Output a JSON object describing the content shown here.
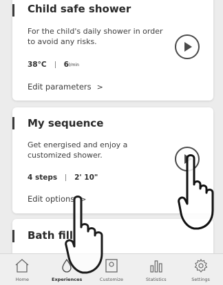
{
  "cards": [
    {
      "title": "Child safe shower",
      "description": "For the child's daily shower in order to avoid any risks.",
      "meta_left": "38°C",
      "meta_right_value": "6",
      "meta_right_unit": "l/min",
      "edit_label": "Edit parameters",
      "chevron": ">"
    },
    {
      "title": "My sequence",
      "description": "Get energised and enjoy a customized shower.",
      "meta_left": "4 steps",
      "meta_right_value": "2' 10\"",
      "edit_label": "Edit options",
      "chevron": ">"
    },
    {
      "title": "Bath fill"
    }
  ],
  "tabs": [
    {
      "label": "Home",
      "icon": "home-icon"
    },
    {
      "label": "Experiences",
      "icon": "drop-icon",
      "active": true
    },
    {
      "label": "Customize",
      "icon": "customize-icon"
    },
    {
      "label": "Statistics",
      "icon": "statistics-icon"
    },
    {
      "label": "Settings",
      "icon": "gear-icon"
    }
  ],
  "colors": {
    "background": "#ececec",
    "card": "#ffffff",
    "text": "#2f2f2f",
    "accent": "#3a3a3a"
  }
}
